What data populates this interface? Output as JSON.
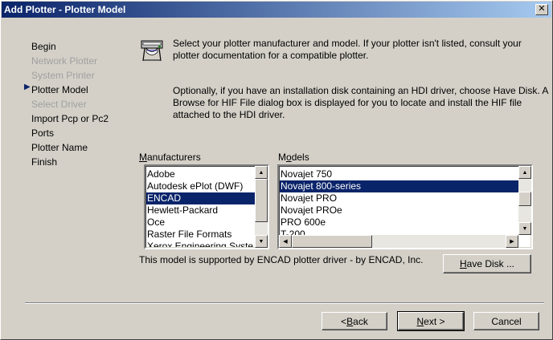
{
  "window": {
    "title": "Add Plotter - Plotter Model",
    "close_label": "✕"
  },
  "steps": [
    {
      "label": "Begin",
      "state": "normal"
    },
    {
      "label": "Network Plotter",
      "state": "disabled"
    },
    {
      "label": "System Printer",
      "state": "disabled"
    },
    {
      "label": "Plotter Model",
      "state": "current"
    },
    {
      "label": "Select Driver",
      "state": "disabled"
    },
    {
      "label": "Import Pcp or Pc2",
      "state": "normal"
    },
    {
      "label": "Ports",
      "state": "normal"
    },
    {
      "label": "Plotter Name",
      "state": "normal"
    },
    {
      "label": "Finish",
      "state": "normal"
    }
  ],
  "current_step_marker": "▶",
  "instructions": {
    "intro": "Select your plotter manufacturer and model. If your plotter isn't listed, consult your plotter documentation for a compatible plotter.",
    "optional": "Optionally, if you have an installation disk containing an HDI driver, choose Have Disk. A Browse for HIF File dialog box is displayed for you to locate and install the HIF file attached to the HDI driver."
  },
  "manufacturers": {
    "label_accel": "M",
    "label_rest": "anufacturers",
    "items": [
      "Adobe",
      "Autodesk ePlot (DWF)",
      "ENCAD",
      "Hewlett-Packard",
      "Oce",
      "Raster File Formats",
      "Xerox Engineering Syste"
    ],
    "selected": "ENCAD"
  },
  "models": {
    "label_pre": "M",
    "label_accel": "o",
    "label_rest": "dels",
    "items": [
      "Novajet 750",
      "Novajet 800-series",
      "Novajet PRO",
      "Novajet PROe",
      "PRO 600e",
      "T-200"
    ],
    "selected": "Novajet 800-series"
  },
  "support_text": "This model is supported by ENCAD plotter driver - by ENCAD, Inc.",
  "buttons": {
    "have_disk_accel": "H",
    "have_disk_rest": "ave Disk ...",
    "back_pre": "< ",
    "back_accel": "B",
    "back_rest": "ack",
    "next_accel": "N",
    "next_rest": "ext >",
    "cancel": "Cancel"
  },
  "colors": {
    "title_bar": "#0a246a",
    "selection": "#0a246a",
    "dialog_face": "#d4d0c8"
  }
}
